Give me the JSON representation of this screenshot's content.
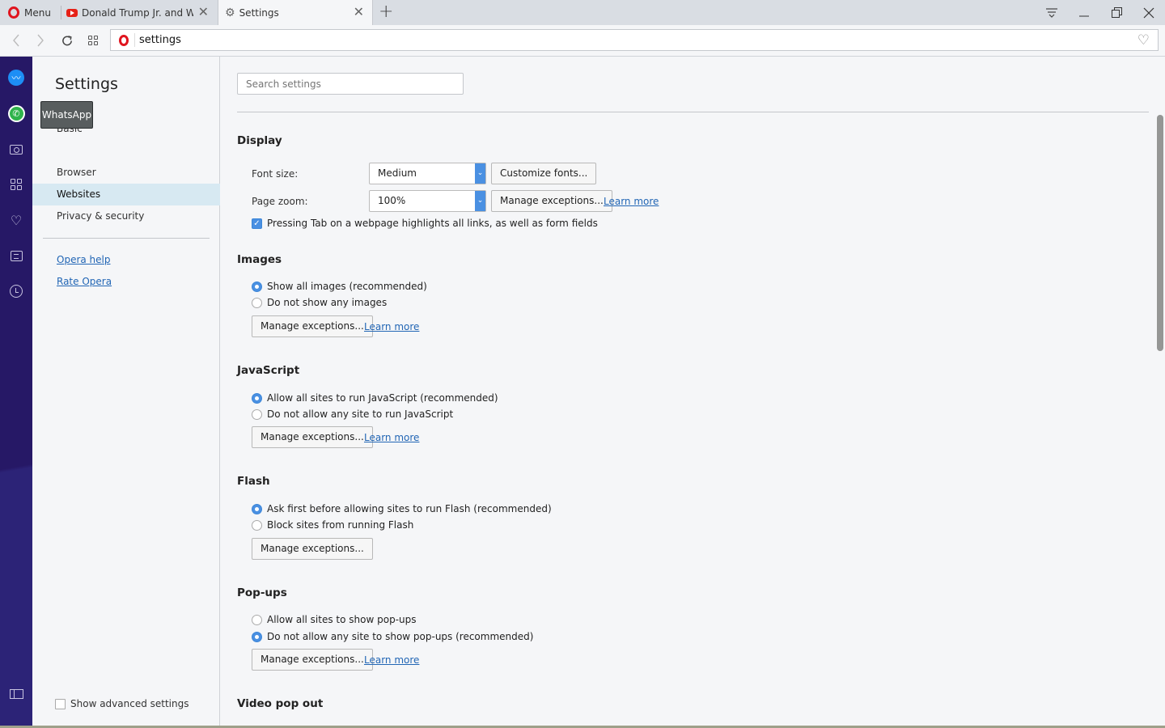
{
  "browser": {
    "menu_label": "Menu",
    "tabs": [
      {
        "title": "Donald Trump Jr. and WikiLeaks",
        "icon": "youtube-icon",
        "active": false
      },
      {
        "title": "Settings",
        "icon": "gear-icon",
        "active": true
      }
    ],
    "address": "settings",
    "window_controls": [
      "tab-menu-icon",
      "minimize-icon",
      "restore-icon",
      "close-icon"
    ]
  },
  "sidebar": {
    "icons": [
      "messenger-icon",
      "whatsapp-icon",
      "camera-icon",
      "speed-dial-icon",
      "heart-icon",
      "news-icon",
      "history-icon"
    ],
    "bottom_icon": "panel-toggle-icon",
    "tooltip": "WhatsApp"
  },
  "settings_nav": {
    "title": "Settings",
    "items": [
      {
        "label": "Basic",
        "active": false
      },
      {
        "label": "Browser",
        "active": false
      },
      {
        "label": "Websites",
        "active": true
      },
      {
        "label": "Privacy & security",
        "active": false
      }
    ],
    "links": [
      "Opera help",
      "Rate Opera"
    ],
    "advanced_label": "Show advanced settings",
    "advanced_checked": false
  },
  "main": {
    "search_placeholder": "Search settings",
    "display": {
      "title": "Display",
      "font_size_label": "Font size:",
      "font_size_value": "Medium",
      "customize_fonts": "Customize fonts...",
      "page_zoom_label": "Page zoom:",
      "page_zoom_value": "100%",
      "manage_exceptions": "Manage exceptions...",
      "learn_more": "Learn more",
      "tab_highlight": "Pressing Tab on a webpage highlights all links, as well as form fields",
      "tab_highlight_checked": true
    },
    "images": {
      "title": "Images",
      "options": [
        "Show all images (recommended)",
        "Do not show any images"
      ],
      "selected": 0,
      "manage_exceptions": "Manage exceptions...",
      "learn_more": "Learn more"
    },
    "javascript": {
      "title": "JavaScript",
      "options": [
        "Allow all sites to run JavaScript (recommended)",
        "Do not allow any site to run JavaScript"
      ],
      "selected": 0,
      "manage_exceptions": "Manage exceptions...",
      "learn_more": "Learn more"
    },
    "flash": {
      "title": "Flash",
      "options": [
        "Ask first before allowing sites to run Flash (recommended)",
        "Block sites from running Flash"
      ],
      "selected": 0,
      "manage_exceptions": "Manage exceptions..."
    },
    "popups": {
      "title": "Pop-ups",
      "options": [
        "Allow all sites to show pop-ups",
        "Do not allow any site to show pop-ups (recommended)"
      ],
      "selected": 1,
      "manage_exceptions": "Manage exceptions...",
      "learn_more": "Learn more"
    },
    "video_popout": {
      "title": "Video pop out"
    }
  },
  "colors": {
    "accent": "#4a90e2",
    "sidebar": "#261866",
    "link": "#2266b5",
    "active_nav": "#d7e9f2"
  }
}
